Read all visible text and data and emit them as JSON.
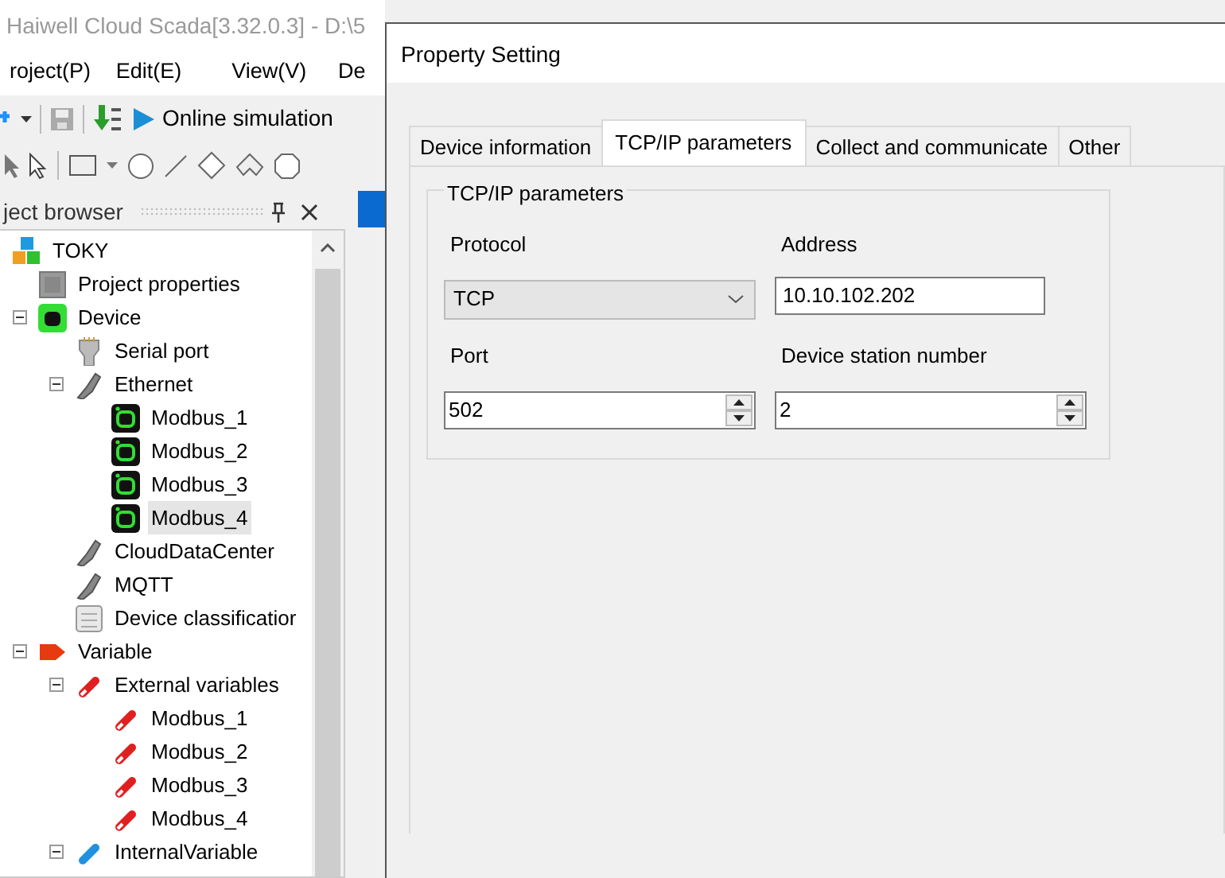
{
  "app": {
    "title": "Haiwell Cloud Scada[3.32.0.3] - D:\\5",
    "menu": [
      "roject(P)",
      "Edit(E)",
      "View(V)",
      "De"
    ],
    "toolbar_button": "Online simulation",
    "browser_title": "ject browser"
  },
  "tree": [
    {
      "label": "TOKY",
      "kind": "root",
      "selected": false,
      "children": [
        {
          "label": "Project properties",
          "kind": "properties",
          "selected": false
        },
        {
          "label": "Device",
          "kind": "device",
          "expanded": true,
          "selected": false,
          "children": [
            {
              "label": "Serial port",
              "kind": "serial",
              "selected": false
            },
            {
              "label": "Ethernet",
              "kind": "network",
              "expanded": true,
              "selected": false,
              "children": [
                {
                  "label": "Modbus_1",
                  "kind": "modbus",
                  "selected": false
                },
                {
                  "label": "Modbus_2",
                  "kind": "modbus",
                  "selected": false
                },
                {
                  "label": "Modbus_3",
                  "kind": "modbus",
                  "selected": false
                },
                {
                  "label": "Modbus_4",
                  "kind": "modbus",
                  "selected": true
                }
              ]
            },
            {
              "label": "CloudDataCenter",
              "kind": "network",
              "selected": false
            },
            {
              "label": "MQTT",
              "kind": "network",
              "selected": false
            },
            {
              "label": "Device classificatior",
              "kind": "classes",
              "selected": false
            }
          ]
        },
        {
          "label": "Variable",
          "kind": "variable",
          "expanded": true,
          "selected": false,
          "children": [
            {
              "label": "External variables",
              "kind": "tag",
              "expanded": true,
              "selected": false,
              "children": [
                {
                  "label": "Modbus_1",
                  "kind": "tag",
                  "selected": false
                },
                {
                  "label": "Modbus_2",
                  "kind": "tag",
                  "selected": false
                },
                {
                  "label": "Modbus_3",
                  "kind": "tag",
                  "selected": false
                },
                {
                  "label": "Modbus_4",
                  "kind": "tag",
                  "selected": false
                }
              ]
            },
            {
              "label": "InternalVariable",
              "kind": "internal",
              "expanded": true,
              "selected": false
            }
          ]
        }
      ]
    }
  ],
  "dialog": {
    "title": "Property Setting",
    "tabs": [
      {
        "label": "Device information",
        "selected": false
      },
      {
        "label": "TCP/IP parameters",
        "selected": true
      },
      {
        "label": "Collect and communicate",
        "selected": false
      },
      {
        "label": "Other",
        "selected": false
      }
    ],
    "group_title": "TCP/IP parameters",
    "fields": [
      {
        "label": "Protocol",
        "kind": "select",
        "value": "TCP"
      },
      {
        "label": "Address",
        "kind": "text",
        "value": "10.10.102.202"
      },
      {
        "label": "Port",
        "kind": "spin",
        "value": "502"
      },
      {
        "label": "Device station number",
        "kind": "spin",
        "value": "2"
      }
    ]
  }
}
